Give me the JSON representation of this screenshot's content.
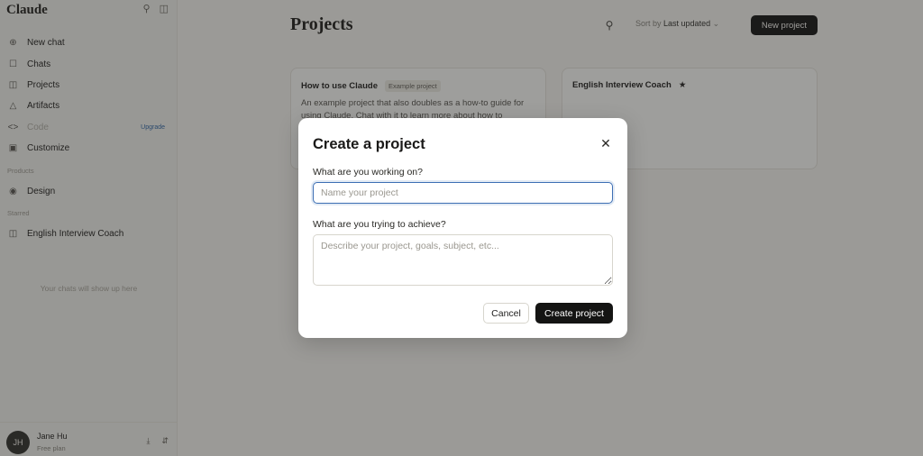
{
  "app": {
    "brand": "Claude"
  },
  "sidebar": {
    "items": [
      {
        "label": "New chat",
        "icon": "plus-circle-icon"
      },
      {
        "label": "Chats",
        "icon": "chat-bubbles-icon"
      },
      {
        "label": "Projects",
        "icon": "folder-icon"
      },
      {
        "label": "Artifacts",
        "icon": "artifacts-icon"
      },
      {
        "label": "Code",
        "icon": "code-icon",
        "badge": "Upgrade"
      },
      {
        "label": "Customize",
        "icon": "briefcase-icon"
      }
    ],
    "products_label": "Products",
    "products": [
      {
        "label": "Design",
        "icon": "palette-icon"
      }
    ],
    "starred_label": "Starred",
    "starred": [
      {
        "label": "English Interview Coach",
        "icon": "folder-icon"
      }
    ],
    "empty_note": "Your chats will show up here"
  },
  "user": {
    "initials": "JH",
    "name": "Jane Hu",
    "plan": "Free plan"
  },
  "main": {
    "title": "Projects",
    "sort_prefix": "Sort by",
    "sort_value": "Last updated",
    "new_project": "New project",
    "cards": [
      {
        "title": "How to use Claude",
        "tag": "Example project",
        "desc": "An example project that also doubles as a how-to guide for using Claude. Chat with it to learn more about how to"
      },
      {
        "title": "English Interview Coach",
        "star": "★"
      }
    ]
  },
  "modal": {
    "title": "Create a project",
    "label_name": "What are you working on?",
    "name_placeholder": "Name your project",
    "name_value": "",
    "label_goal": "What are you trying to achieve?",
    "goal_placeholder": "Describe your project, goals, subject, etc...",
    "cancel": "Cancel",
    "create": "Create project"
  },
  "colors": {
    "accent_focus": "#3d6fb4",
    "primary_button": "#141413",
    "upgrade_link": "#3b6ea8"
  }
}
